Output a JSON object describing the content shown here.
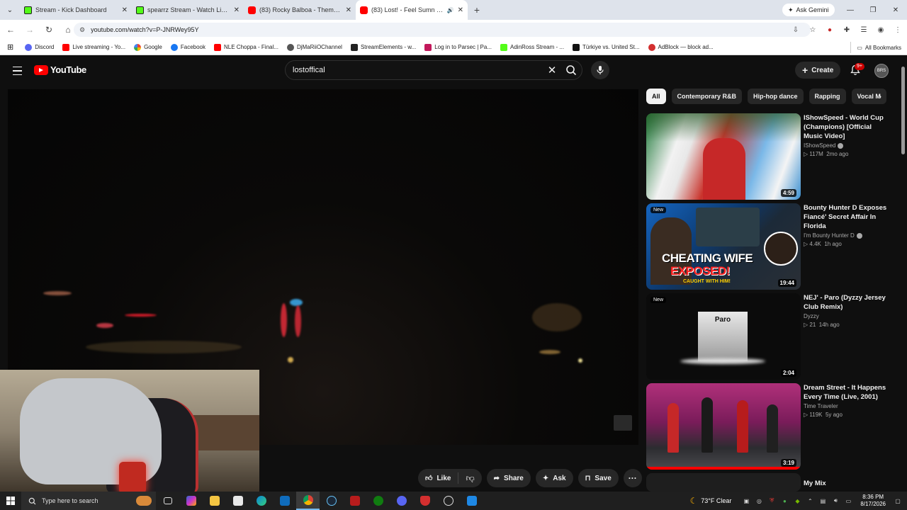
{
  "browser": {
    "tabs": [
      {
        "title": "Stream - Kick Dashboard",
        "favicon": "kick-icon",
        "active": false
      },
      {
        "title": "spearrz Stream - Watch Live on",
        "favicon": "kick-icon",
        "active": false
      },
      {
        "title": "(83) Rocky Balboa - Theme Song",
        "favicon": "youtube-icon",
        "active": false
      },
      {
        "title": "(83) Lost! - Feel Sumn (Offic",
        "favicon": "youtube-icon",
        "active": true
      }
    ],
    "ask_gemini": "Ask Gemini",
    "url": "youtube.com/watch?v=P-JNRWey95Y",
    "bookmarks": [
      {
        "label": "Discord",
        "color": "#5865f2"
      },
      {
        "label": "Live streaming - Yo...",
        "color": "#ff0000"
      },
      {
        "label": "Google",
        "color": "#4285f4"
      },
      {
        "label": "Facebook",
        "color": "#1877f2"
      },
      {
        "label": "NLE Choppa - Final...",
        "color": "#ff0000"
      },
      {
        "label": "DjMaRiiOChannel",
        "color": "#555555"
      },
      {
        "label": "StreamElements - w...",
        "color": "#222222"
      },
      {
        "label": "Log in to Parsec | Pa...",
        "color": "#c2185b"
      },
      {
        "label": "AdinRoss Stream - ...",
        "color": "#53fc18"
      },
      {
        "label": "Türkiye vs. United St...",
        "color": "#111111"
      },
      {
        "label": "AdBlock — block ad...",
        "color": "#d32f2f"
      }
    ],
    "all_bookmarks": "All Bookmarks"
  },
  "youtube": {
    "logo_text": "YouTube",
    "search_query": "lostoffical",
    "create_label": "Create",
    "notification_count": "9+",
    "avatar_text": "BRS",
    "actions": {
      "like": "Like",
      "share": "Share",
      "ask": "Ask",
      "save": "Save"
    },
    "chips": [
      "All",
      "Contemporary R&B",
      "Hip-hop dance",
      "Rapping",
      "Vocal M"
    ],
    "recommendations": [
      {
        "title": "IShowSpeed - World Cup (Champions) [Official Music Video]",
        "channel": "IShowSpeed",
        "verified": true,
        "views": "117M",
        "age": "2mo ago",
        "duration": "4:59",
        "is_new": false
      },
      {
        "title": "Bounty Hunter D Exposes Fiancé' Secret Affair In Florida",
        "channel": "I'm Bounty Hunter D",
        "verified": true,
        "views": "4.4K",
        "age": "1h ago",
        "duration": "19:44",
        "is_new": true,
        "thumb_text_1": "CHEATING WIFE",
        "thumb_text_2": "EXPOSED!",
        "thumb_text_3": "CAUGHT WITH HIM!"
      },
      {
        "title": "NEJ' - Paro (Dyzzy Jersey Club Remix)",
        "channel": "Dyzzy",
        "verified": false,
        "views": "21",
        "age": "14h ago",
        "duration": "2:04",
        "is_new": true,
        "thumb_text_1": "Paro"
      },
      {
        "title": "Dream Street - It Happens Every Time (Live, 2001)",
        "channel": "Time Traveler",
        "verified": false,
        "views": "119K",
        "age": "5y ago",
        "duration": "3:19",
        "is_new": false
      },
      {
        "title": "My Mix"
      }
    ]
  },
  "taskbar": {
    "search_placeholder": "Type here to search",
    "weather": "73°F  Clear",
    "time": "8:36 PM",
    "date": "8/17/2026"
  },
  "colors": {
    "yt_red": "#ff0000",
    "kick_green": "#53fc18",
    "chip_bg": "#272727",
    "page_bg": "#0f0f0f"
  }
}
